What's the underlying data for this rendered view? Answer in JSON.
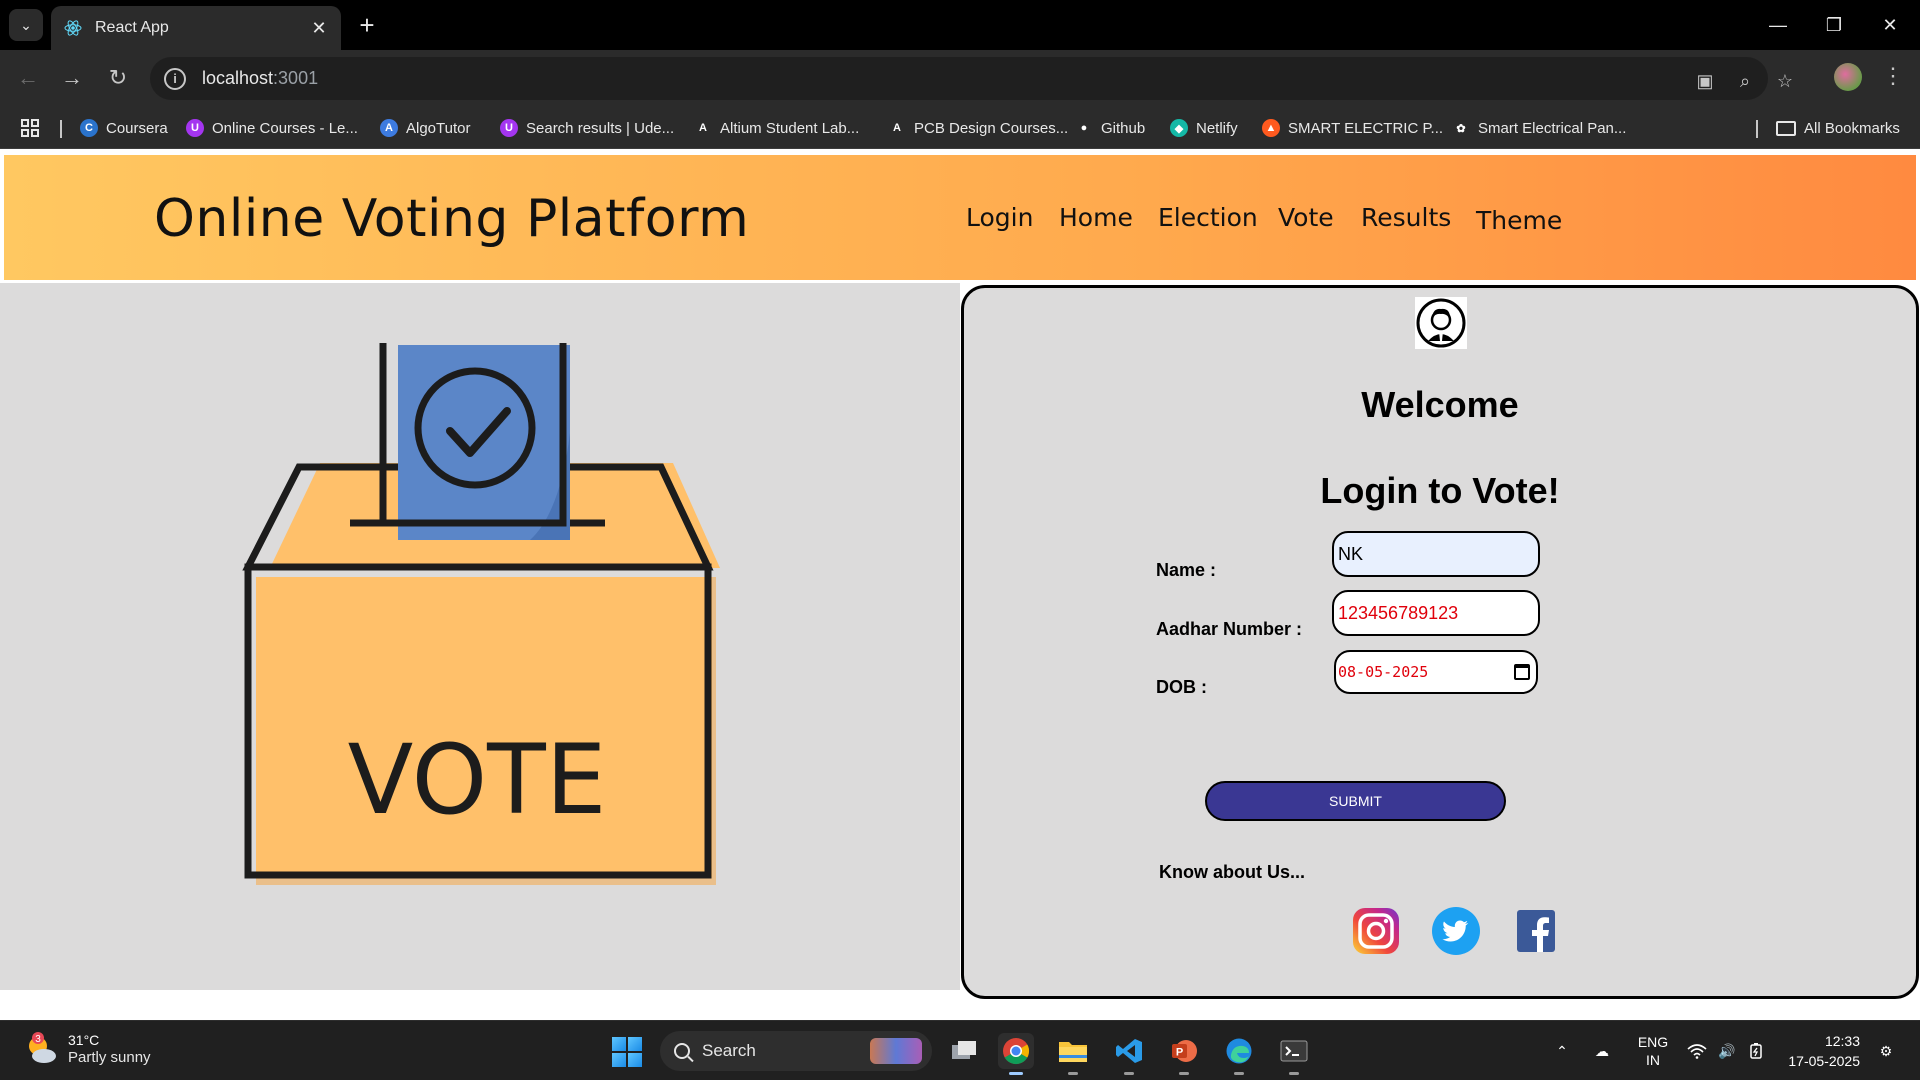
{
  "browser": {
    "tab_title": "React App",
    "url_host": "localhost",
    "url_port": ":3001",
    "bookmarks": [
      {
        "label": "Coursera",
        "icon": "coursera-icon",
        "color": "#2a73cc"
      },
      {
        "label": "Online Courses - Le...",
        "icon": "udemy-icon",
        "color": "#a435f0"
      },
      {
        "label": "AlgoTutor",
        "icon": "algotutor-icon",
        "color": "#3d7be0"
      },
      {
        "label": "Search results | Ude...",
        "icon": "udemy-icon",
        "color": "#a435f0"
      },
      {
        "label": "Altium Student Lab...",
        "icon": "altium-icon",
        "color": "#ffffff"
      },
      {
        "label": "PCB Design Courses...",
        "icon": "altium-icon",
        "color": "#ffffff"
      },
      {
        "label": "Github",
        "icon": "github-icon",
        "color": "#ffffff"
      },
      {
        "label": "Netlify",
        "icon": "netlify-icon",
        "color": "#14b8a6"
      },
      {
        "label": "SMART ELECTRIC P...",
        "icon": "flame-icon",
        "color": "#ff5a1f"
      },
      {
        "label": "Smart Electrical Pan...",
        "icon": "openai-icon",
        "color": "#ffffff"
      }
    ],
    "all_bookmarks": "All Bookmarks"
  },
  "header": {
    "title": "Online Voting Platform",
    "nav": [
      "Login",
      "Home",
      "Election",
      "Vote",
      "Results",
      "Theme"
    ]
  },
  "hero": {
    "ballot_text": "VOTE"
  },
  "login": {
    "welcome": "Welcome",
    "subtitle": "Login to Vote!",
    "name_label": "Name :",
    "name_value": "NK",
    "aadhar_label": "Aadhar Number :",
    "aadhar_value": "123456789123",
    "dob_label": "DOB :",
    "dob_value": "08-05-2025",
    "submit_label": "SUBMIT",
    "know_label": "Know about Us..."
  },
  "taskbar": {
    "weather_badge": "3",
    "temperature": "31°C",
    "weather_desc": "Partly sunny",
    "search_placeholder": "Search",
    "lang_1": "ENG",
    "lang_2": "IN",
    "time": "12:33",
    "date": "17-05-2025"
  },
  "colors": {
    "header_gradient_start": "#ffc861",
    "header_gradient_end": "#ff8a40",
    "panel_bg": "#dcdbdb",
    "submit_bg": "#3a3793",
    "invalid_text": "#e0000b"
  }
}
